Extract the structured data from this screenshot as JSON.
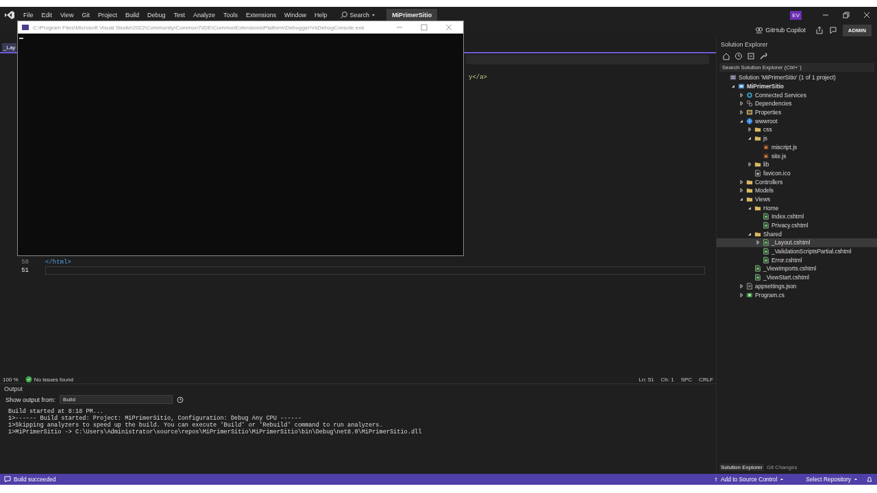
{
  "menu_bar": {
    "items": [
      "File",
      "Edit",
      "View",
      "Git",
      "Project",
      "Build",
      "Debug",
      "Test",
      "Analyze",
      "Tools",
      "Extensions",
      "Window",
      "Help"
    ],
    "search": "Search",
    "solution_name": "MiPrimerSitio",
    "user_initials": "EV"
  },
  "toolbar": {
    "copilot": "GitHub Copilot",
    "account": "ADMIN"
  },
  "console_window": {
    "title": "C:\\Program Files\\Microsoft Visual Studio\\2022\\Community\\Common7\\IDE\\CommonExtensions\\Platform\\Debugger\\VsDebugConsole.exe"
  },
  "editor": {
    "tabs": [
      {
        "label": "_Lay",
        "selected": true
      }
    ],
    "code_fragment": "y</a>",
    "lines": [
      {
        "number": "50",
        "code": "</html>",
        "current": false
      },
      {
        "number": "51",
        "current": true
      }
    ],
    "status": {
      "zoom": "100 %",
      "issues": "No issues found",
      "line": "Ln: 51",
      "char": "Ch: 1",
      "whitespace": "SPC",
      "line_ending": "CRLF"
    }
  },
  "output": {
    "title": "Output",
    "source_label": "Show output from:",
    "source": "Build",
    "lines": [
      "Build started at 8:18 PM...",
      "1>------ Build started: Project: MiPrimerSitio, Configuration: Debug Any CPU ------",
      "1>Skipping analyzers to speed up the build. You can execute 'Build' or 'Rebuild' command to run analyzers.",
      "1>MiPrimerSitio -> C:\\Users\\Administrator\\source\\repos\\MiPrimerSitio\\MiPrimerSitio\\bin\\Debug\\net8.0\\MiPrimerSitio.dll"
    ]
  },
  "solution_explorer": {
    "title": "Solution Explorer",
    "search_placeholder": "Search Solution Explorer (Ctrl+´)",
    "tree": [
      {
        "label": "Solution 'MiPrimerSitio' (1 of 1 project)",
        "kind": "solution",
        "selected": false,
        "children": [
          {
            "label": "MiPrimerSitio",
            "kind": "project",
            "bold": true,
            "expanded": true,
            "selected": false,
            "children": [
              {
                "label": "Connected Services",
                "kind": "service",
                "expanded": false,
                "selected": false
              },
              {
                "label": "Dependencies",
                "kind": "dependencies",
                "expanded": false,
                "selected": false
              },
              {
                "label": "Properties",
                "kind": "properties",
                "expanded": false,
                "selected": false
              },
              {
                "label": "wwwroot",
                "kind": "web",
                "expanded": true,
                "selected": false,
                "children": [
                  {
                    "label": "css",
                    "kind": "folder",
                    "expanded": false,
                    "selected": false
                  },
                  {
                    "label": "js",
                    "kind": "folder",
                    "expanded": true,
                    "selected": false,
                    "children": [
                      {
                        "label": "miscript.js",
                        "kind": "script",
                        "selected": false
                      },
                      {
                        "label": "site.js",
                        "kind": "script",
                        "selected": false
                      }
                    ]
                  },
                  {
                    "label": "lib",
                    "kind": "folder",
                    "expanded": false,
                    "selected": false
                  },
                  {
                    "label": "favicon.ico",
                    "kind": "file",
                    "selected": false
                  }
                ]
              },
              {
                "label": "Controllers",
                "kind": "folder",
                "expanded": false,
                "selected": false
              },
              {
                "label": "Models",
                "kind": "folder",
                "expanded": false,
                "selected": false
              },
              {
                "label": "Views",
                "kind": "folder",
                "expanded": true,
                "selected": false,
                "children": [
                  {
                    "label": "Home",
                    "kind": "folder",
                    "expanded": true,
                    "selected": false,
                    "children": [
                      {
                        "label": "Index.cshtml",
                        "kind": "page",
                        "selected": false
                      },
                      {
                        "label": "Privacy.cshtml",
                        "kind": "page",
                        "selected": false
                      }
                    ]
                  },
                  {
                    "label": "Shared",
                    "kind": "folder",
                    "expanded": true,
                    "selected": false,
                    "children": [
                      {
                        "label": "_Layout.cshtml",
                        "kind": "page",
                        "expanded": false,
                        "selected": true
                      },
                      {
                        "label": "_ValidationScriptsPartial.cshtml",
                        "kind": "page",
                        "selected": false
                      },
                      {
                        "label": "Error.cshtml",
                        "kind": "page",
                        "selected": false
                      }
                    ]
                  },
                  {
                    "label": "_ViewImports.cshtml",
                    "kind": "page",
                    "selected": false
                  },
                  {
                    "label": "_ViewStart.cshtml",
                    "kind": "page",
                    "selected": false
                  }
                ]
              },
              {
                "label": "appsettings.json",
                "kind": "settings",
                "expanded": false,
                "selected": false
              },
              {
                "label": "Program.cs",
                "kind": "csharp",
                "expanded": false,
                "selected": false
              }
            ]
          }
        ]
      }
    ],
    "bottom_tabs": [
      {
        "label": "Solution Explorer",
        "selected": true
      },
      {
        "label": "Git Changes",
        "selected": false
      }
    ]
  },
  "status_bar": {
    "message": "Build succeeded",
    "source_control": "Add to Source Control",
    "repository": "Select Repository"
  }
}
